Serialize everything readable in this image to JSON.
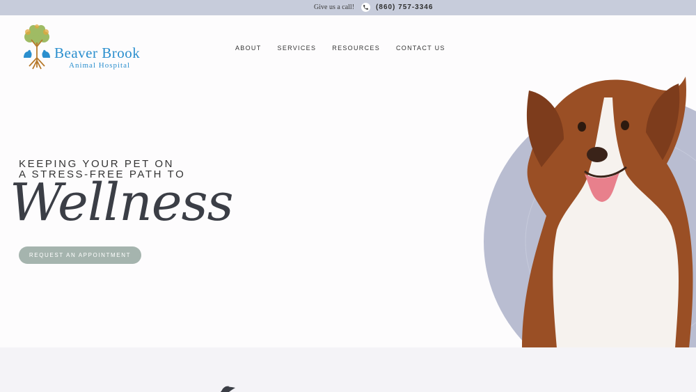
{
  "topbar": {
    "call_text": "Give us a call!",
    "phone": "(860) 757-3346"
  },
  "logo": {
    "title": "Beaver Brook",
    "subtitle": "Animal Hospital"
  },
  "nav": [
    "ABOUT",
    "SERVICES",
    "RESOURCES",
    "CONTACT US"
  ],
  "hero": {
    "line1": "KEEPING YOUR PET ON",
    "line2": "A STRESS-FREE PATH TO",
    "script": "Wellness",
    "cta": "REQUEST AN APPOINTMENT"
  },
  "colors": {
    "topbar": "#c7ccdb",
    "brand": "#2b8fce",
    "cta": "#a5b4ae",
    "circle": "#b9bdd1",
    "dog": "#9a4f25"
  },
  "icons": [
    "phone-icon",
    "tree-logo-icon",
    "dog-illustration",
    "leaf-icon"
  ]
}
